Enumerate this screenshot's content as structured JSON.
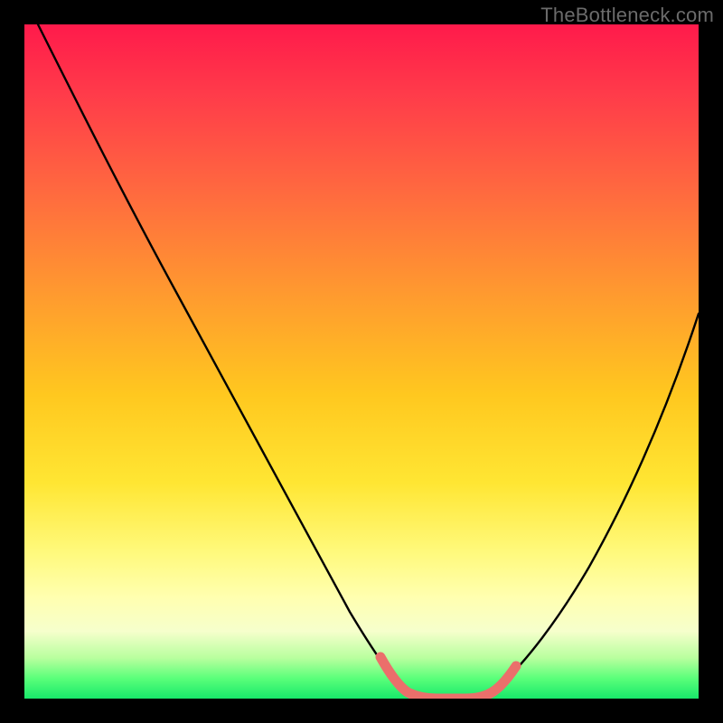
{
  "watermark": "TheBottleneck.com",
  "colors": {
    "frame": "#000000",
    "gradient_top": "#ff1a4b",
    "gradient_mid1": "#ff9a2f",
    "gradient_mid2": "#ffe633",
    "gradient_bottom": "#18e86a",
    "curve": "#000000",
    "valley_marker": "#eb6f6b"
  },
  "chart_data": {
    "type": "line",
    "title": "",
    "xlabel": "",
    "ylabel": "",
    "xlim": [
      0,
      100
    ],
    "ylim": [
      0,
      100
    ],
    "x": [
      2,
      6,
      10,
      14,
      18,
      22,
      26,
      30,
      34,
      38,
      42,
      46,
      50,
      52,
      54,
      56,
      58,
      60,
      62,
      64,
      68,
      72,
      76,
      80,
      84,
      88,
      92,
      96,
      100
    ],
    "y": [
      100,
      93,
      86,
      79,
      72,
      65,
      58,
      51,
      44,
      37,
      30,
      23,
      15,
      10,
      6,
      3,
      1,
      0,
      0,
      0,
      2,
      6,
      12,
      20,
      29,
      38,
      46,
      53,
      59
    ],
    "valley_range_x": [
      52,
      66
    ],
    "notes": "Values estimated from pixel positions; y=0 at bottom (green), y=100 at top (red). Curve is a V-shaped bottleneck profile with flat minimum ~x 58–64."
  }
}
